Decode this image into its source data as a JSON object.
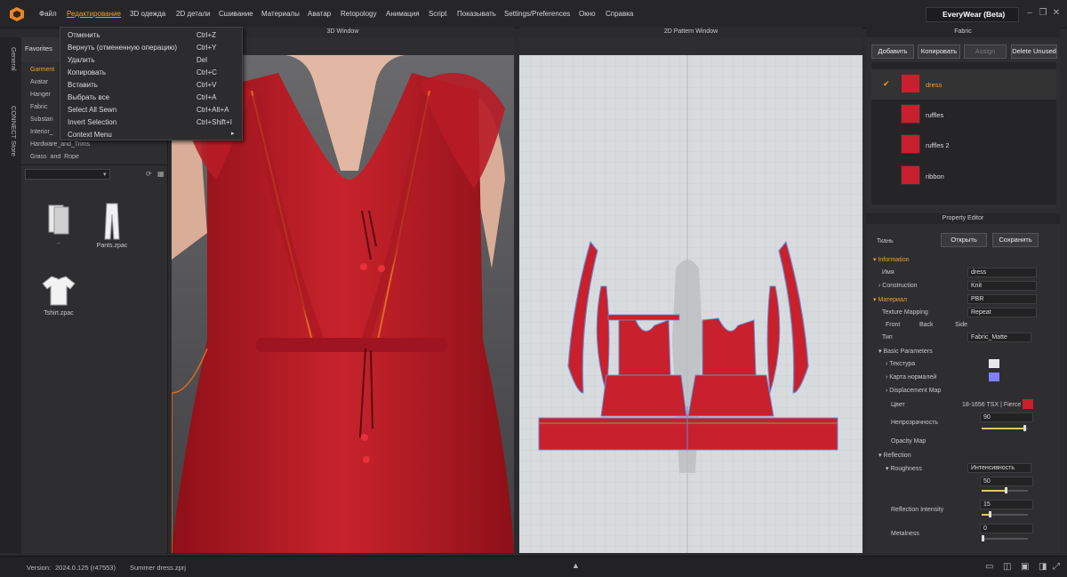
{
  "menu": {
    "items": [
      "Файл",
      "Редактирование",
      "3D одежда",
      "2D детали",
      "Сшивание",
      "Материалы",
      "Аватар",
      "Retopology",
      "Анимация",
      "Script",
      "Показывать",
      "Settings/Preferences",
      "Окно",
      "Справка"
    ],
    "product": "EveryWear (Beta)"
  },
  "edit_menu": {
    "items": [
      {
        "label": "Отменить",
        "shortcut": "Ctrl+Z"
      },
      {
        "label": "Вернуть (отмененную операцию)",
        "shortcut": "Ctrl+Y"
      },
      {
        "label": "Удалить",
        "shortcut": "Del"
      },
      {
        "label": "Копировать",
        "shortcut": "Ctrl+C"
      },
      {
        "label": "Вставить",
        "shortcut": "Ctrl+V"
      },
      {
        "label": "Выбрать все",
        "shortcut": "Ctrl+A"
      },
      {
        "label": "Select All Sewn",
        "shortcut": "Ctrl+Alt+A"
      },
      {
        "label": "Invert Selection",
        "shortcut": "Ctrl+Shift+I"
      },
      {
        "label": "Context Menu",
        "shortcut": ""
      }
    ]
  },
  "left_tabs": [
    "General",
    "CONNECT Store"
  ],
  "library": {
    "tab": "Favorites",
    "tree": [
      "Garment",
      "Avatar",
      "Hanger",
      "Fabric",
      "Substan",
      "Interior_",
      "Hardware_and_Trims",
      "Grass_and_Rope"
    ],
    "files": [
      "..",
      "Pants.zpac",
      "Tshirt.zpac"
    ]
  },
  "view3d": {
    "title": "3D Window"
  },
  "view2d": {
    "title": "2D Pattern Window"
  },
  "fabric": {
    "title": "Fabric",
    "buttons": {
      "add": "Добавить",
      "copy": "Копировать",
      "assign": "Assign",
      "delete_unused": "Delete Unused"
    },
    "items": [
      "dress",
      "ruffles",
      "ruffles 2",
      "ribbon"
    ],
    "swatch_color": "#c8202c"
  },
  "property": {
    "title": "Property Editor",
    "kind": "Ткань",
    "open_btn": "Открыть",
    "save_btn": "Сохранить",
    "information": "Information",
    "name_label": "Имя",
    "name_value": "dress",
    "construction_label": "Construction",
    "construction_value": "Knit",
    "material_label": "Материал",
    "material_value": "PBR",
    "texture_mapping_label": "Texture Mapping",
    "texture_mapping_value": "Repeat",
    "sides": [
      "Front",
      "Back",
      "Side"
    ],
    "type_label": "Тип",
    "type_value": "Fabric_Matte",
    "basic_params": "Basic Parameters",
    "texture_label": "Текстура",
    "normal_map_label": "Карта нормалей",
    "displacement_label": "Displacement Map",
    "color_label": "Цвет",
    "color_value": "18-1656 TSX | Fierce",
    "opacity_label": "Непрозрачность",
    "opacity_value": "90",
    "opacity_map_label": "Opacity Map",
    "reflection_label": "Reflection",
    "roughness_label": "Roughness",
    "roughness_mode": "Интенсивность",
    "roughness_value": "50",
    "refl_intensity_label": "Reflection Intensity",
    "refl_intensity_value": "15",
    "metalness_label": "Metalness",
    "metalness_value": "0",
    "accent_color": "#f0a030",
    "normal_swatch": "#8080ff"
  },
  "status": {
    "version_label": "Version:",
    "version_value": "2024.0.125 (r47553)",
    "file_name": "Summer dress.zprj"
  }
}
